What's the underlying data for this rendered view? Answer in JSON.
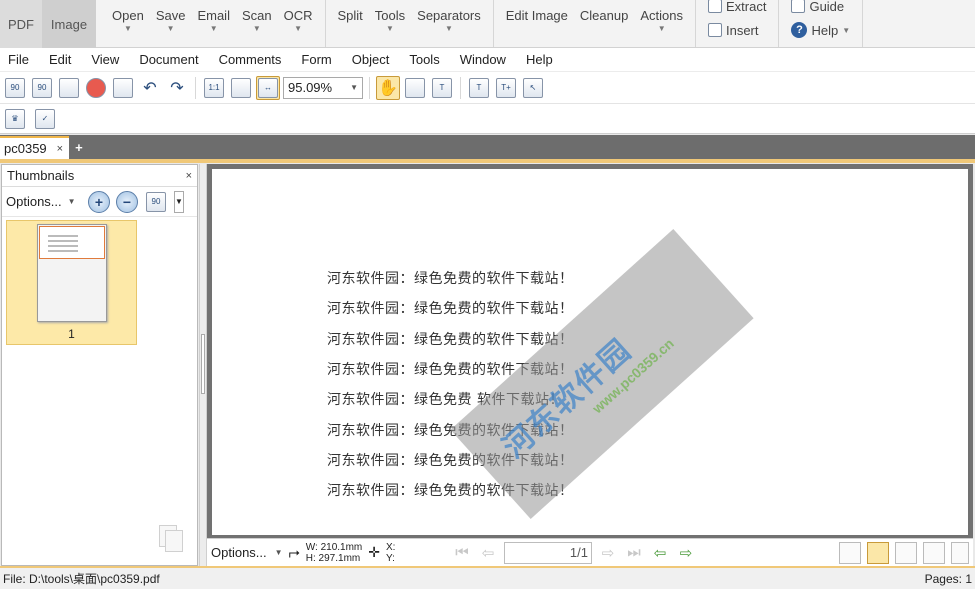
{
  "ribbon": {
    "tabs": [
      "PDF",
      "Image"
    ],
    "buttons": [
      "Open",
      "Save",
      "Email",
      "Scan",
      "OCR",
      "Split",
      "Tools",
      "Separators",
      "Edit Image",
      "Cleanup",
      "Actions"
    ],
    "small": [
      "Extract",
      "Insert",
      "Guide",
      "Help"
    ]
  },
  "menu": [
    "File",
    "Edit",
    "View",
    "Document",
    "Comments",
    "Form",
    "Object",
    "Tools",
    "Window",
    "Help"
  ],
  "toolbar": {
    "zoom": "95.09%"
  },
  "doc_tab": {
    "name": "pc0359",
    "close": "×",
    "new": "+"
  },
  "thumbnails": {
    "title": "Thumbnails",
    "close": "×",
    "options": "Options...",
    "page_number": "1"
  },
  "document": {
    "lines": [
      "河东软件园：绿色免费的软件下载站！",
      "河东软件园：绿色免费的软件下载站！",
      "河东软件园：绿色免费的软件下载站！",
      "河东软件园：绿色免费的软件下载站！",
      "河东软件园：绿色免费   软件下载站！",
      "河东软件园：绿色免费的软件下载站！",
      "河东软件园：绿色免费的软件下载站！",
      "河东软件园：绿色免费的软件下载站！"
    ],
    "watermark": "河东软件园",
    "watermark_url": "www.pc0359.cn"
  },
  "doc_status": {
    "options": "Options...",
    "width": "W:  210.1mm",
    "height": "H:  297.1mm",
    "x": "X:",
    "y": "Y:",
    "page": "1/1"
  },
  "status": {
    "file": "File: D:\\tools\\桌面\\pc0359.pdf",
    "pages": "Pages: 1"
  }
}
